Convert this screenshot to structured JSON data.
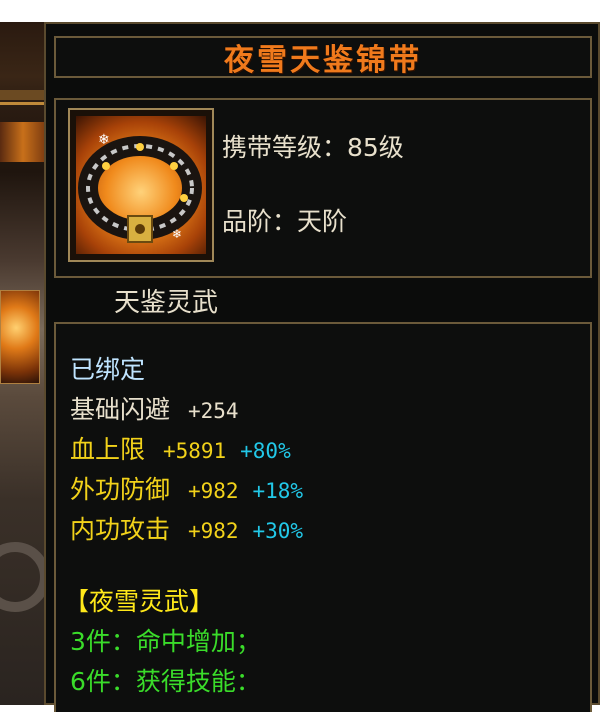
{
  "item": {
    "name": "夜雪天鉴锦带",
    "icon": "belt-icon",
    "carry_level_label": "携带等级：85级",
    "grade_label": "品阶：天阶",
    "category": "天鉴灵武"
  },
  "bound_status": "已绑定",
  "attributes": [
    {
      "name": "基础闪避",
      "value": "+254",
      "bonus": "",
      "color": "#e8e0cc"
    },
    {
      "name": "血上限",
      "value": "+5891",
      "bonus": "+80%",
      "color": "#f2d21a"
    },
    {
      "name": "外功防御",
      "value": "+982",
      "bonus": "+18%",
      "color": "#f2d21a"
    },
    {
      "name": "内功攻击",
      "value": "+982",
      "bonus": "+30%",
      "color": "#f2d21a"
    }
  ],
  "set": {
    "name": "【夜雪灵武】",
    "bonuses": [
      "3件：命中增加；",
      "6件：获得技能："
    ]
  },
  "colors": {
    "title": "#f07a1c",
    "bonus_percent": "#22c8e8",
    "set_bonus": "#3adc2a",
    "border": "#6b5a3a"
  }
}
